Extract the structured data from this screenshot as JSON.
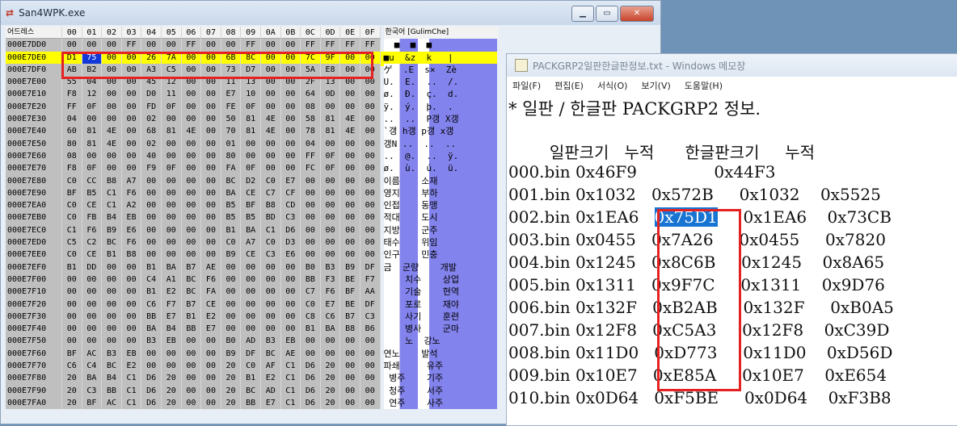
{
  "hex_window": {
    "title": "San4WPK.exe",
    "header": {
      "address_label": "어드레스",
      "columns": [
        "00",
        "01",
        "02",
        "03",
        "04",
        "05",
        "06",
        "07",
        "08",
        "09",
        "0A",
        "0B",
        "0C",
        "0D",
        "0E",
        "0F"
      ],
      "text_label": "한국어 [GulimChe]"
    },
    "rows": [
      {
        "addr": "000E7DD0",
        "bytes": [
          "00",
          "00",
          "00",
          "FF",
          "00",
          "00",
          "FF",
          "00",
          "00",
          "FF",
          "00",
          "00",
          "FF",
          "FF",
          "FF",
          "FF"
        ],
        "text": "  ■  ■  ■     "
      },
      {
        "addr": "000E7DE0",
        "bytes": [
          "D1",
          "75",
          "00",
          "00",
          "26",
          "7A",
          "00",
          "00",
          "6B",
          "8C",
          "00",
          "00",
          "7C",
          "9F",
          "00",
          "00"
        ],
        "text": "■u  &z  k   |  "
      },
      {
        "addr": "000E7DF0",
        "bytes": [
          "AB",
          "B2",
          "00",
          "00",
          "A3",
          "C5",
          "00",
          "00",
          "73",
          "D7",
          "00",
          "00",
          "5A",
          "E8",
          "00",
          "00"
        ],
        "text": "ゲ  .E  s×  Zè "
      },
      {
        "addr": "000E7E00",
        "bytes": [
          "55",
          "04",
          "00",
          "00",
          "45",
          "12",
          "00",
          "00",
          "11",
          "13",
          "00",
          "00",
          "2F",
          "13",
          "00",
          "00"
        ],
        "text": "U.  E.  ..  /. "
      },
      {
        "addr": "000E7E10",
        "bytes": [
          "F8",
          "12",
          "00",
          "00",
          "D0",
          "11",
          "00",
          "00",
          "E7",
          "10",
          "00",
          "00",
          "64",
          "0D",
          "00",
          "00"
        ],
        "text": "ø.  Ð.  ç.  d. "
      },
      {
        "addr": "000E7E20",
        "bytes": [
          "FF",
          "0F",
          "00",
          "00",
          "FD",
          "0F",
          "00",
          "00",
          "FE",
          "0F",
          "00",
          "00",
          "08",
          "00",
          "00",
          "00"
        ],
        "text": "ÿ.  ý.  þ.  .  "
      },
      {
        "addr": "000E7E30",
        "bytes": [
          "04",
          "00",
          "00",
          "00",
          "02",
          "00",
          "00",
          "00",
          "50",
          "81",
          "4E",
          "00",
          "58",
          "81",
          "4E",
          "00"
        ],
        "text": "..  ..  P갱 X갱"
      },
      {
        "addr": "000E7E40",
        "bytes": [
          "60",
          "81",
          "4E",
          "00",
          "68",
          "81",
          "4E",
          "00",
          "70",
          "81",
          "4E",
          "00",
          "78",
          "81",
          "4E",
          "00"
        ],
        "text": "`갱 h갱 p갱 x갱"
      },
      {
        "addr": "000E7E50",
        "bytes": [
          "80",
          "81",
          "4E",
          "00",
          "02",
          "00",
          "00",
          "00",
          "01",
          "00",
          "00",
          "00",
          "04",
          "00",
          "00",
          "00"
        ],
        "text": "갱N ..  ..  .. "
      },
      {
        "addr": "000E7E60",
        "bytes": [
          "08",
          "00",
          "00",
          "00",
          "40",
          "00",
          "00",
          "00",
          "80",
          "00",
          "00",
          "00",
          "FF",
          "0F",
          "00",
          "00"
        ],
        "text": "..  @.  ..  ÿ. "
      },
      {
        "addr": "000E7E70",
        "bytes": [
          "F8",
          "0F",
          "00",
          "00",
          "F9",
          "0F",
          "00",
          "00",
          "FA",
          "0F",
          "00",
          "00",
          "FC",
          "0F",
          "00",
          "00"
        ],
        "text": "ø.  ù.  ú.  ü. "
      },
      {
        "addr": "000E7E80",
        "bytes": [
          "C0",
          "CC",
          "B8",
          "A7",
          "00",
          "00",
          "00",
          "00",
          "BC",
          "D2",
          "C0",
          "E7",
          "00",
          "00",
          "00",
          "00"
        ],
        "text": "이름    소재    "
      },
      {
        "addr": "000E7E90",
        "bytes": [
          "BF",
          "B5",
          "C1",
          "F6",
          "00",
          "00",
          "00",
          "00",
          "BA",
          "CE",
          "C7",
          "CF",
          "00",
          "00",
          "00",
          "00"
        ],
        "text": "영지    부하    "
      },
      {
        "addr": "000E7EA0",
        "bytes": [
          "C0",
          "CE",
          "C1",
          "A2",
          "00",
          "00",
          "00",
          "00",
          "B5",
          "BF",
          "B8",
          "CD",
          "00",
          "00",
          "00",
          "00"
        ],
        "text": "인접    동맹    "
      },
      {
        "addr": "000E7EB0",
        "bytes": [
          "C0",
          "FB",
          "B4",
          "EB",
          "00",
          "00",
          "00",
          "00",
          "B5",
          "B5",
          "BD",
          "C3",
          "00",
          "00",
          "00",
          "00"
        ],
        "text": "적대    도시    "
      },
      {
        "addr": "000E7EC0",
        "bytes": [
          "C1",
          "F6",
          "B9",
          "E6",
          "00",
          "00",
          "00",
          "00",
          "B1",
          "BA",
          "C1",
          "D6",
          "00",
          "00",
          "00",
          "00"
        ],
        "text": "지방    군주    "
      },
      {
        "addr": "000E7ED0",
        "bytes": [
          "C5",
          "C2",
          "BC",
          "F6",
          "00",
          "00",
          "00",
          "00",
          "C0",
          "A7",
          "C0",
          "D3",
          "00",
          "00",
          "00",
          "00"
        ],
        "text": "태수    위임    "
      },
      {
        "addr": "000E7EE0",
        "bytes": [
          "C0",
          "CE",
          "B1",
          "B8",
          "00",
          "00",
          "00",
          "00",
          "B9",
          "CE",
          "C3",
          "E6",
          "00",
          "00",
          "00",
          "00"
        ],
        "text": "인구    민충    "
      },
      {
        "addr": "000E7EF0",
        "bytes": [
          "B1",
          "DD",
          "00",
          "00",
          "B1",
          "BA",
          "B7",
          "AE",
          "00",
          "00",
          "00",
          "00",
          "B0",
          "B3",
          "B9",
          "DF"
        ],
        "text": "금  군량    개발"
      },
      {
        "addr": "000E7F00",
        "bytes": [
          "00",
          "00",
          "00",
          "00",
          "C4",
          "A1",
          "BC",
          "F6",
          "00",
          "00",
          "00",
          "00",
          "BB",
          "F3",
          "BE",
          "F7"
        ],
        "text": "    치수    상업"
      },
      {
        "addr": "000E7F10",
        "bytes": [
          "00",
          "00",
          "00",
          "00",
          "B1",
          "E2",
          "BC",
          "FA",
          "00",
          "00",
          "00",
          "00",
          "C7",
          "F6",
          "BF",
          "AA"
        ],
        "text": "    기술    현역"
      },
      {
        "addr": "000E7F20",
        "bytes": [
          "00",
          "00",
          "00",
          "00",
          "C6",
          "F7",
          "B7",
          "CE",
          "00",
          "00",
          "00",
          "00",
          "C0",
          "E7",
          "BE",
          "DF"
        ],
        "text": "    포로    재야"
      },
      {
        "addr": "000E7F30",
        "bytes": [
          "00",
          "00",
          "00",
          "00",
          "BB",
          "E7",
          "B1",
          "E2",
          "00",
          "00",
          "00",
          "00",
          "C8",
          "C6",
          "B7",
          "C3"
        ],
        "text": "    사기    훈련"
      },
      {
        "addr": "000E7F40",
        "bytes": [
          "00",
          "00",
          "00",
          "00",
          "BA",
          "B4",
          "BB",
          "E7",
          "00",
          "00",
          "00",
          "00",
          "B1",
          "BA",
          "B8",
          "B6"
        ],
        "text": "    병사    군마"
      },
      {
        "addr": "000E7F50",
        "bytes": [
          "00",
          "00",
          "00",
          "00",
          "B3",
          "EB",
          "00",
          "00",
          "B0",
          "AD",
          "B3",
          "EB",
          "00",
          "00",
          "00",
          "00"
        ],
        "text": "    노  강노    "
      },
      {
        "addr": "000E7F60",
        "bytes": [
          "BF",
          "AC",
          "B3",
          "EB",
          "00",
          "00",
          "00",
          "00",
          "B9",
          "DF",
          "BC",
          "AE",
          "00",
          "00",
          "00",
          "00"
        ],
        "text": "연노    발석    "
      },
      {
        "addr": "000E7F70",
        "bytes": [
          "C6",
          "C4",
          "BC",
          "E2",
          "00",
          "00",
          "00",
          "00",
          "20",
          "C0",
          "AF",
          "C1",
          "D6",
          "20",
          "00",
          "00"
        ],
        "text": "파쇄     유주   "
      },
      {
        "addr": "000E7F80",
        "bytes": [
          "20",
          "BA",
          "B4",
          "C1",
          "D6",
          "20",
          "00",
          "00",
          "20",
          "B1",
          "E2",
          "C1",
          "D6",
          "20",
          "00",
          "00"
        ],
        "text": " 병주    기주   "
      },
      {
        "addr": "000E7F90",
        "bytes": [
          "20",
          "C3",
          "BB",
          "C1",
          "D6",
          "20",
          "00",
          "00",
          "20",
          "BC",
          "AD",
          "C1",
          "D6",
          "20",
          "00",
          "00"
        ],
        "text": " 청주    서주   "
      },
      {
        "addr": "000E7FA0",
        "bytes": [
          "20",
          "BF",
          "AC",
          "C1",
          "D6",
          "20",
          "00",
          "00",
          "20",
          "BB",
          "E7",
          "C1",
          "D6",
          "20",
          "00",
          "00"
        ],
        "text": " 연주    사주   "
      }
    ],
    "selected_row": 1,
    "cursor": {
      "row": 1,
      "col": 1
    }
  },
  "notepad": {
    "title": "PACKGRP2일판한글판정보.txt - Windows 메모장",
    "menu": [
      "파일(F)",
      "편집(E)",
      "서식(O)",
      "보기(V)",
      "도움말(H)"
    ],
    "lines": [
      "* 일판 / 한글판 PACKGRP2 정보.",
      "",
      "        일판크기   누적      한글판크기     누적",
      "000.bin 0x46F9               0x44F3",
      "001.bin 0x1032   0x572B     0x1032    0x5525",
      "002.bin 0x1EA6   0x75D1     0x1EA6    0x73CB",
      "003.bin 0x0455   0x7A26     0x0455     0x7820",
      "004.bin 0x1245   0x8C6B     0x1245    0x8A65",
      "005.bin 0x1311   0x9F7C     0x1311    0x9D76",
      "006.bin 0x132F   0xB2AB     0x132F     0xB0A5",
      "007.bin 0x12F8   0xC5A3     0x12F8    0xC39D",
      "008.bin 0x11D0   0xD773     0x11D0    0xD56D",
      "009.bin 0x10E7   0xE85A     0x10E7    0xE654",
      "010.bin 0x0D64   0xF5BE     0x0D64    0xF3B8"
    ],
    "selected_text": "0x75D1"
  },
  "colors": {
    "highlight_box": "#e52222",
    "row_select": "#ffff00",
    "cursor": "#1338d8",
    "text_select": "#1874d2"
  }
}
